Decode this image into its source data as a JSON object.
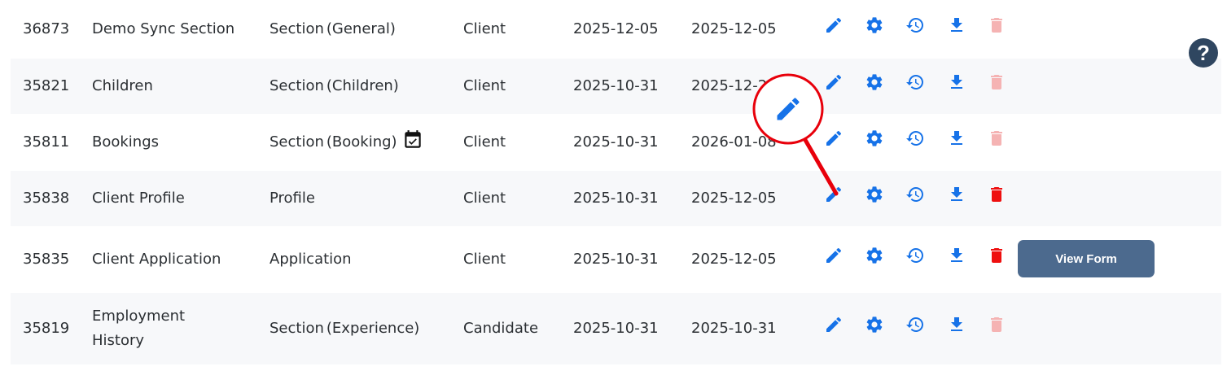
{
  "rows": [
    {
      "id": "36873",
      "name": "Demo Sync Section",
      "type": "Section",
      "type_detail": "(General)",
      "owner": "Client",
      "created": "2025-12-05",
      "updated": "2025-12-05",
      "delete_enabled": false
    },
    {
      "id": "35821",
      "name": "Children",
      "type": "Section",
      "type_detail": "(Children)",
      "owner": "Client",
      "created": "2025-10-31",
      "updated": "2025-12-22",
      "delete_enabled": false
    },
    {
      "id": "35811",
      "name": "Bookings",
      "type": "Section",
      "type_detail": "(Booking)",
      "owner": "Client",
      "created": "2025-10-31",
      "updated": "2026-01-08",
      "delete_enabled": false,
      "calendar_icon": "calendar-check-icon"
    },
    {
      "id": "35838",
      "name": "Client Profile",
      "type": "Profile",
      "type_detail": "",
      "owner": "Client",
      "created": "2025-10-31",
      "updated": "2025-12-05",
      "delete_enabled": true
    },
    {
      "id": "35835",
      "name": "Client Application",
      "type": "Application",
      "type_detail": "",
      "owner": "Client",
      "created": "2025-10-31",
      "updated": "2025-12-05",
      "delete_enabled": true,
      "view_form_label": "View Form"
    },
    {
      "id": "35819",
      "name": "Employment History",
      "type": "Section",
      "type_detail": "(Experience)",
      "owner": "Candidate",
      "created": "2025-10-31",
      "updated": "2025-10-31",
      "delete_enabled": false
    }
  ],
  "actions": [
    "pencil-icon",
    "gear-icon",
    "history-icon",
    "download-icon",
    "trash-icon"
  ],
  "help": {
    "label": "?"
  },
  "callout": {
    "icon": "pencil-icon",
    "color": "#e8000b"
  },
  "colors": {
    "action_blue": "#1672e8",
    "delete_active": "#ee0f0f",
    "delete_disabled": "#f5b3b3",
    "button_bg": "#4c6a8e",
    "row_alt": "#f7f8fa"
  }
}
